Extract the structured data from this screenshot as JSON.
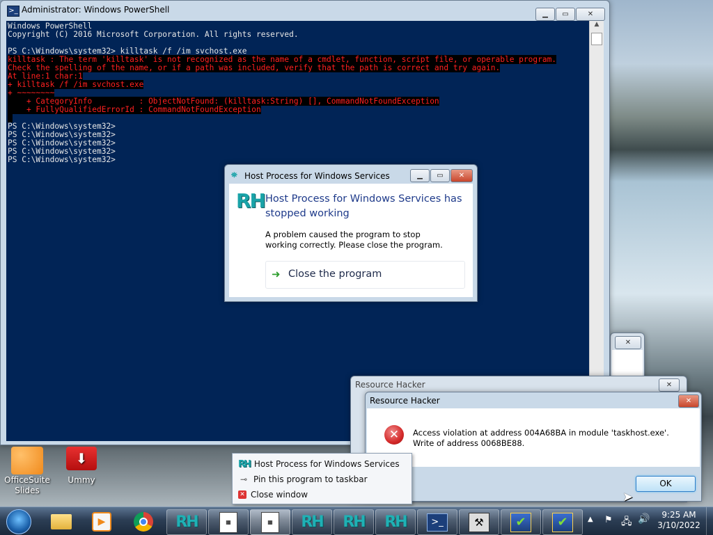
{
  "powershell": {
    "title": "Administrator: Windows PowerShell",
    "lines": [
      {
        "text": "Windows PowerShell",
        "err": false
      },
      {
        "text": "Copyright (C) 2016 Microsoft Corporation. All rights reserved.",
        "err": false
      },
      {
        "text": "",
        "err": false
      },
      {
        "text": "PS C:\\Windows\\system32> killtask /f /im svchost.exe",
        "err": false
      },
      {
        "text": "killtask : The term 'killtask' is not recognized as the name of a cmdlet, function, script file, or operable program.",
        "err": true
      },
      {
        "text": "Check the spelling of the name, or if a path was included, verify that the path is correct and try again.",
        "err": true
      },
      {
        "text": "At line:1 char:1",
        "err": true
      },
      {
        "text": "+ killtask /f /im svchost.exe",
        "err": true
      },
      {
        "text": "+ ~~~~~~~~",
        "err": true
      },
      {
        "text": "    + CategoryInfo          : ObjectNotFound: (killtask:String) [], CommandNotFoundException",
        "err": true
      },
      {
        "text": "    + FullyQualifiedErrorId : CommandNotFoundException",
        "err": true
      },
      {
        "text": " ",
        "err": true
      },
      {
        "text": "PS C:\\Windows\\system32>",
        "err": false
      },
      {
        "text": "PS C:\\Windows\\system32>",
        "err": false
      },
      {
        "text": "PS C:\\Windows\\system32>",
        "err": false
      },
      {
        "text": "PS C:\\Windows\\system32>",
        "err": false
      },
      {
        "text": "PS C:\\Windows\\system32>",
        "err": false
      }
    ]
  },
  "host_dialog": {
    "title": "Host Process for Windows Services",
    "heading": "Host Process for Windows Services has stopped working",
    "message": "A problem caused the program to stop working correctly. Please close the program.",
    "action": "Close the program",
    "logo": "RH"
  },
  "rh_outer": {
    "title": "Resource Hacker"
  },
  "rh_inner": {
    "title": "Resource Hacker",
    "message": "Access violation at address 004A68BA in module 'taskhost.exe'. Write of address 0068BE88.",
    "ok": "OK"
  },
  "jumplist": {
    "items": [
      "Host Process for Windows Services",
      "Pin this program to taskbar",
      "Close window"
    ]
  },
  "desktop": {
    "icons": [
      {
        "label": "OfficeSuite\nSlides"
      },
      {
        "label": "Ummy"
      }
    ]
  },
  "taskbar": {
    "rh_label": "RH",
    "clock_time": "9:25 AM",
    "clock_date": "3/10/2022"
  },
  "colors": {
    "ps_background": "#012456",
    "ps_error": "#ff2020",
    "rh_logo": "#1aa3a8",
    "error_icon": "#d42a2a"
  }
}
